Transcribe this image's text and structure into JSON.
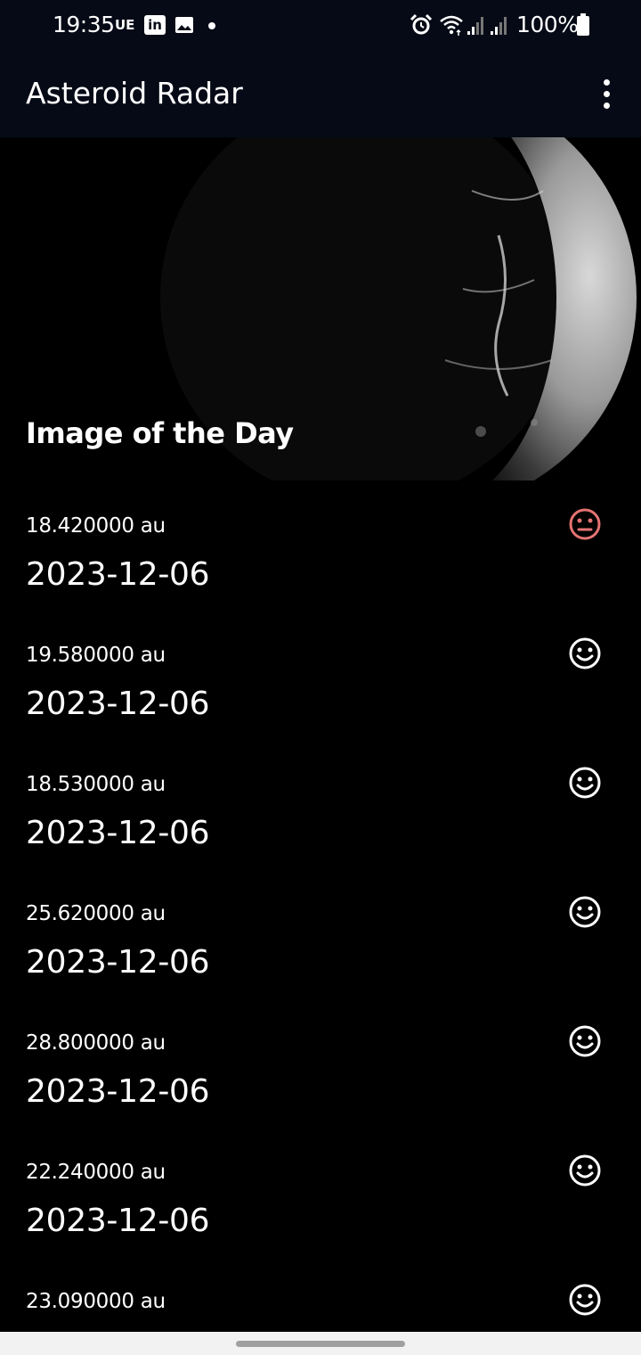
{
  "status_bar": {
    "time": "19:35",
    "carrier_tag": "UE",
    "linkedin_label": "in",
    "battery_percent": "100%"
  },
  "app_bar": {
    "title": "Asteroid Radar"
  },
  "image_of_day": {
    "title": "Image of the Day"
  },
  "colors": {
    "hazardous": "#e57373",
    "safe": "#ffffff",
    "app_bar_bg": "#050a16"
  },
  "asteroids": [
    {
      "distance": "18.420000 au",
      "date": "2023-12-06",
      "status_icon": "neutral-face-icon",
      "hazardous": true
    },
    {
      "distance": "19.580000 au",
      "date": "2023-12-06",
      "status_icon": "happy-face-icon",
      "hazardous": false
    },
    {
      "distance": "18.530000 au",
      "date": "2023-12-06",
      "status_icon": "happy-face-icon",
      "hazardous": false
    },
    {
      "distance": "25.620000 au",
      "date": "2023-12-06",
      "status_icon": "happy-face-icon",
      "hazardous": false
    },
    {
      "distance": "28.800000 au",
      "date": "2023-12-06",
      "status_icon": "happy-face-icon",
      "hazardous": false
    },
    {
      "distance": "22.240000 au",
      "date": "2023-12-06",
      "status_icon": "happy-face-icon",
      "hazardous": false
    },
    {
      "distance": "23.090000 au",
      "date": "",
      "status_icon": "happy-face-icon",
      "hazardous": false
    }
  ]
}
